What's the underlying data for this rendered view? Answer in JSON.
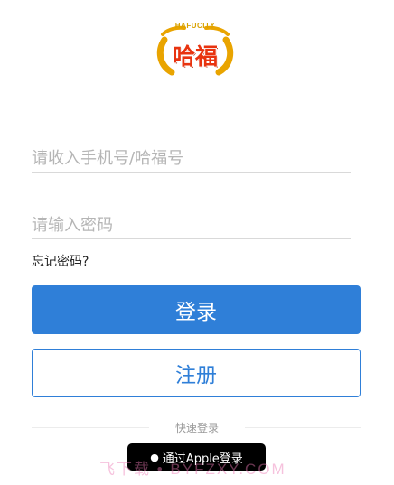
{
  "logo": {
    "brand_text": "HAFUCITY",
    "text": "哈福"
  },
  "form": {
    "phone_placeholder": "请收入手机号/哈福号",
    "password_placeholder": "请输入密码",
    "forgot_label": "忘记密码?"
  },
  "buttons": {
    "login_label": "登录",
    "register_label": "注册"
  },
  "quick_login": {
    "label": "快速登录",
    "apple_label": "通过Apple登录"
  },
  "watermark": "飞下载 • BYFZXY.COM",
  "colors": {
    "primary": "#2f7fd8",
    "logo_red": "#e8330f",
    "logo_gold": "#d9a200"
  }
}
